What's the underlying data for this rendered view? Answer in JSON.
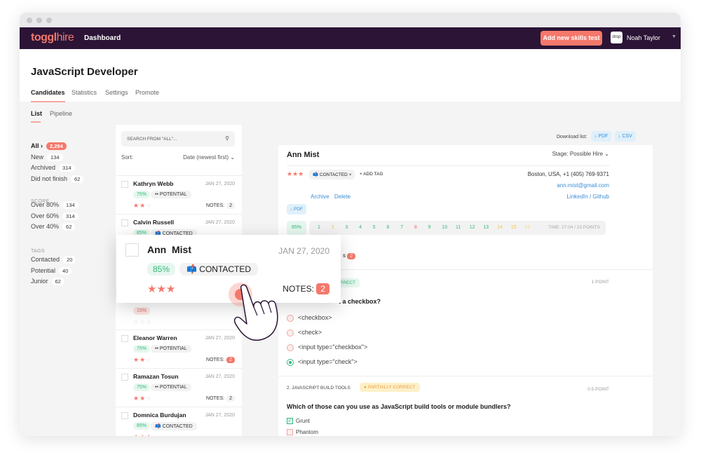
{
  "app": {
    "logo_bold": "toggl",
    "logo_light": "hire",
    "nav_link": "Dashboard",
    "add_test": "Add new skills test",
    "avatar_text": "drop",
    "user": "Noah Taylor"
  },
  "page": {
    "title": "JavaScript Developer",
    "tabs": [
      "Candidates",
      "Statistics",
      "Settings",
      "Promote"
    ],
    "subtabs": [
      "List",
      "Pipeline"
    ]
  },
  "filters": {
    "main": [
      {
        "label": "All ›",
        "count": "2,294"
      },
      {
        "label": "New",
        "count": "134"
      },
      {
        "label": "Archived",
        "count": "314"
      },
      {
        "label": "Did not finish",
        "count": "62"
      }
    ],
    "score_title": "SCORE",
    "score": [
      {
        "label": "Over 80%",
        "count": "134"
      },
      {
        "label": "Over 60%",
        "count": "314"
      },
      {
        "label": "Over 40%",
        "count": "62"
      }
    ],
    "tags_title": "TAGS",
    "tags": [
      {
        "label": "Contacted",
        "count": "20"
      },
      {
        "label": "Potential",
        "count": "40"
      },
      {
        "label": "Junior",
        "count": "62"
      }
    ]
  },
  "list": {
    "search_placeholder": "SEARCH FROM \"ALL\"...",
    "sort_label": "Sort:",
    "sort_value": "Date (newest first)",
    "items": [
      {
        "name": "Kathryn Webb",
        "date": "JAN 27, 2020",
        "score": "75%",
        "tag": "•• POTENTIAL",
        "stars": 2,
        "notes_label": "NOTES:",
        "notes": "2"
      },
      {
        "name": "Calvin Russell",
        "date": "JAN 27, 2020",
        "score": "85%",
        "tag": "📫 CONTACTED",
        "stars": 3
      },
      {
        "score": "15%",
        "stars": 0
      },
      {
        "name": "Eleanor Warren",
        "date": "JAN 27, 2020",
        "score": "75%",
        "tag": "•• POTENTIAL",
        "stars": 2,
        "notes_label": "NOTES:",
        "notes": "2",
        "notes_highlight": true
      },
      {
        "name": "Ramazan Tosun",
        "date": "JAN 27, 2020",
        "score": "75%",
        "tag": "•• POTENTIAL",
        "stars": 2,
        "notes_label": "NOTES:",
        "notes": "2"
      },
      {
        "name": "Domnica Burdujan",
        "date": "JAN 27, 2020",
        "score": "85%",
        "tag": "📫 CONTACTED",
        "stars": 3
      }
    ]
  },
  "popup": {
    "name": "Ann  Mist",
    "date": "JAN 27, 2020",
    "score": "85%",
    "tag": "📫 CONTACTED",
    "stars": 3,
    "notes_label": "NOTES:",
    "notes": "2"
  },
  "download": {
    "label": "Download list:",
    "pdf": "↓ PDF",
    "csv": "↓ CSV"
  },
  "detail": {
    "name": "Ann Mist",
    "stage": "Stage: Possible Hire",
    "stars": 3,
    "tag": "📫 CONTACTED",
    "tag_remove": "×",
    "add_tag": "+ ADD TAG",
    "location": "Boston, USA, +1 (405) 769-9371",
    "email": "ann.mist@gmail.com",
    "linkedin": "LinkedIn",
    "sep": "/",
    "github": "Github",
    "pdf": "↓ PDF",
    "archive": "Archive",
    "delete": "Delete",
    "score": "85%",
    "questions": [
      {
        "n": "1",
        "status": "correct"
      },
      {
        "n": "2",
        "status": "partial"
      },
      {
        "n": "3",
        "status": "correct"
      },
      {
        "n": "4",
        "status": "correct"
      },
      {
        "n": "5",
        "status": "correct"
      },
      {
        "n": "6",
        "status": "correct"
      },
      {
        "n": "7",
        "status": "correct"
      },
      {
        "n": "8",
        "status": "wrong"
      },
      {
        "n": "9",
        "status": "correct"
      },
      {
        "n": "10",
        "status": "correct"
      },
      {
        "n": "11",
        "status": "correct"
      },
      {
        "n": "12",
        "status": "correct"
      },
      {
        "n": "13",
        "status": "correct"
      },
      {
        "n": "14",
        "status": "partial"
      },
      {
        "n": "15",
        "status": "partial"
      },
      {
        "n": "16",
        "status": "unanswered"
      }
    ],
    "time": "TIME: 27:04  /  23 POINTS",
    "notes_tail": "s",
    "notes_count": "2",
    "q1": {
      "badge": "CORRECT",
      "points": "1 POINT",
      "text": "t a checkbox?",
      "options": [
        "<checkbox>",
        "<check>",
        "<input type=\"checkbox\">",
        "<input type=\"check\">"
      ],
      "selected": 3
    },
    "q2": {
      "title": "2. JAVASCRIPT BUILD TOOLS",
      "badge": "● PARTIALLY CORRECT",
      "points": "0.5 POINT",
      "text": "Which of those can you use as JavaScript build tools or module bundlers?",
      "options": [
        "Grunt",
        "Phantom"
      ],
      "checked": [
        0
      ]
    }
  },
  "colors": {
    "nav": "#2b1436",
    "accent": "#f5786b",
    "green": "#35b97a",
    "yellow": "#f3c44b",
    "red": "#e0706a",
    "link": "#3a8fd6"
  }
}
